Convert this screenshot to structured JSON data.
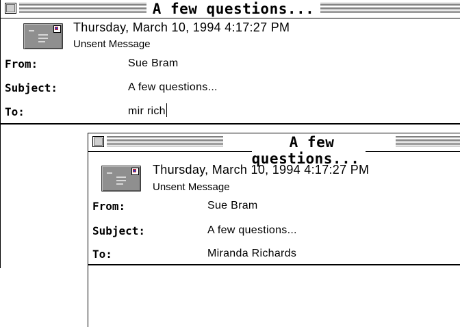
{
  "back_window": {
    "title": "A few questions...",
    "date": "Thursday, March 10, 1994 4:17:27 PM",
    "status": "Unsent Message",
    "fields": {
      "from_label": "From:",
      "from_value": "Sue Bram",
      "subject_label": "Subject:",
      "subject_value": "A few questions...",
      "to_label": "To:",
      "to_value": "mir rich"
    }
  },
  "front_window": {
    "title": "A few questions...",
    "date": "Thursday, March 10, 1994 4:17:27 PM",
    "status": "Unsent Message",
    "fields": {
      "from_label": "From:",
      "from_value": "Sue Bram",
      "subject_label": "Subject:",
      "subject_value": "A few questions...",
      "to_label": "To:",
      "to_value": "Miranda Richards"
    }
  },
  "icons": {
    "message_icon": "envelope-icon",
    "close_icon": "close-box-icon"
  }
}
